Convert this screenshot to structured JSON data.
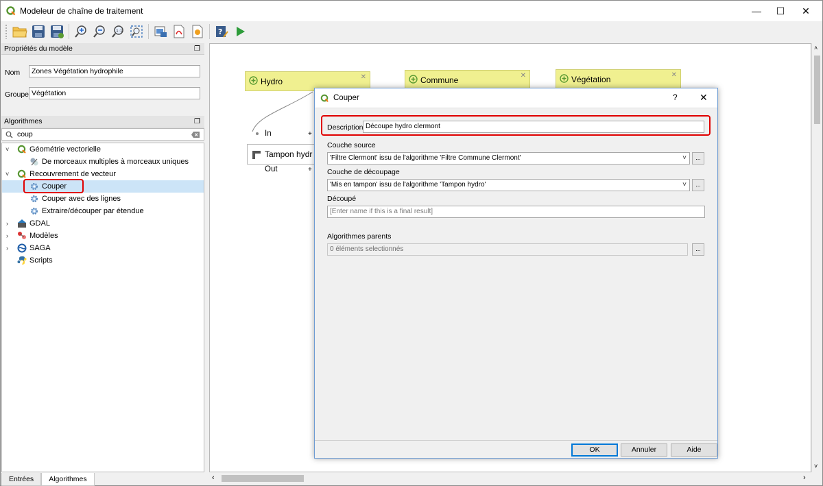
{
  "window": {
    "title": "Modeleur de chaîne de traitement",
    "min": "—",
    "max": "☐",
    "close": "✕"
  },
  "toolbar": {
    "open": "open-model-icon",
    "save": "save-model-icon",
    "save_as": "save-model-as-icon",
    "zoom_in": "zoom-in-icon",
    "zoom_out": "zoom-out-icon",
    "zoom_actual": "zoom-actual-icon",
    "zoom_full": "zoom-full-icon",
    "export_image": "export-image-icon",
    "export_pdf": "export-pdf-icon",
    "export_svg": "export-svg-icon",
    "edit_help": "edit-help-icon",
    "run": "run-icon"
  },
  "properties": {
    "header": "Propriétés du modèle",
    "name_label": "Nom",
    "name_value": "Zones Végétation hydrophile",
    "group_label": "Groupe",
    "group_value": "Végétation"
  },
  "algorithms": {
    "header": "Algorithmes",
    "search_value": "coup",
    "tree": [
      {
        "label": "Géométrie vectorielle",
        "expanded": "˅"
      },
      {
        "label": "De morceaux multiples à morceaux uniques"
      },
      {
        "label": "Recouvrement de vecteur",
        "expanded": "˅"
      },
      {
        "label": "Couper"
      },
      {
        "label": "Couper avec des lignes"
      },
      {
        "label": "Extraire/découper par étendue"
      },
      {
        "label": "GDAL",
        "expanded": "›"
      },
      {
        "label": "Modèles",
        "expanded": "›"
      },
      {
        "label": "SAGA",
        "expanded": "›"
      },
      {
        "label": "Scripts"
      }
    ]
  },
  "bottom_tabs": [
    {
      "label": "Entrées"
    },
    {
      "label": "Algorithmes"
    }
  ],
  "canvas": {
    "nodes": [
      {
        "label": "Hydro"
      },
      {
        "label": "Commune"
      },
      {
        "label": "Végétation"
      }
    ],
    "alg_node": {
      "label": "Tampon hydr",
      "in_label": "In",
      "out_label": "Out",
      "plus": "+"
    }
  },
  "dialog": {
    "title": "Couper",
    "help": "?",
    "close": "✕",
    "description_label": "Description",
    "description_value": "Découpe hydro clermont",
    "source_label": "Couche source",
    "source_value": "'Filtre Clermont' issu de l'algorithme 'Filtre Commune Clermont'",
    "overlay_label": "Couche de découpage",
    "overlay_value": "'Mis en tampon' issu de l'algorithme 'Tampon hydro'",
    "output_label": "Découpé",
    "output_placeholder": "[Enter name if this is a final result]",
    "parents_label": "Algorithmes parents",
    "parents_value": "0 éléments selectionnés",
    "browse": "...",
    "ok": "OK",
    "cancel": "Annuler",
    "help_btn": "Aide"
  },
  "colors": {
    "highlight": "#e00000",
    "node_fill": "#f0f090",
    "selection": "#cce4f7"
  }
}
